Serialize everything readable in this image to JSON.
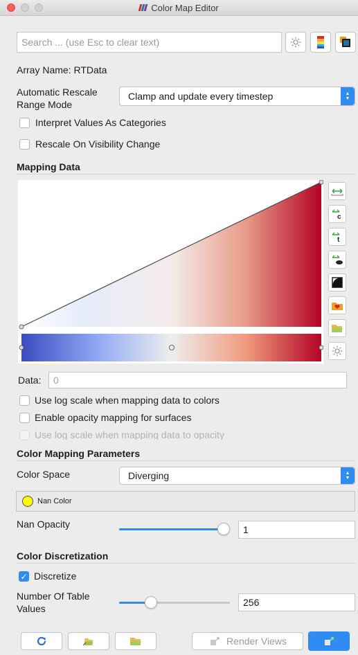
{
  "window": {
    "title": "Color Map Editor"
  },
  "search": {
    "placeholder": "Search ... (use Esc to clear text)"
  },
  "array_name": "Array Name: RTData",
  "rescale": {
    "label": "Automatic Rescale\nRange Mode",
    "value": "Clamp and update every timestep"
  },
  "options": {
    "interpret_categories": "Interpret Values As Categories",
    "rescale_visibility": "Rescale On Visibility Change"
  },
  "mapping": {
    "heading": "Mapping Data",
    "data_label": "Data:",
    "data_placeholder": "0",
    "log_scale_colors": "Use log scale when mapping data to colors",
    "opacity_mapping": "Enable opacity mapping for surfaces",
    "log_scale_opacity": "Use log scale when mapping data to opacity",
    "colors": {
      "low": "#3b4cc0",
      "mid": "#dddddd",
      "high": "#b40426"
    }
  },
  "color_params": {
    "heading": "Color Mapping Parameters",
    "color_space_label": "Color Space",
    "color_space_value": "Diverging",
    "nan_color_label": "Nan Color",
    "nan_color": "#ffff00",
    "nan_opacity_label": "Nan Opacity",
    "nan_opacity_value": "1",
    "nan_opacity_level": 1.0
  },
  "discretization": {
    "heading": "Color Discretization",
    "discretize_label": "Discretize",
    "discretize_checked": true,
    "table_values_label": "Number Of Table\nValues",
    "table_values_value": "256",
    "table_values_level": 0.26
  },
  "footer": {
    "render_views_label": "Render Views"
  },
  "icons": {
    "settings": "gear-icon",
    "colormap_preset": "colorbar-icon",
    "favorites": "favorites-icon"
  },
  "accent": "#2f8cf3"
}
